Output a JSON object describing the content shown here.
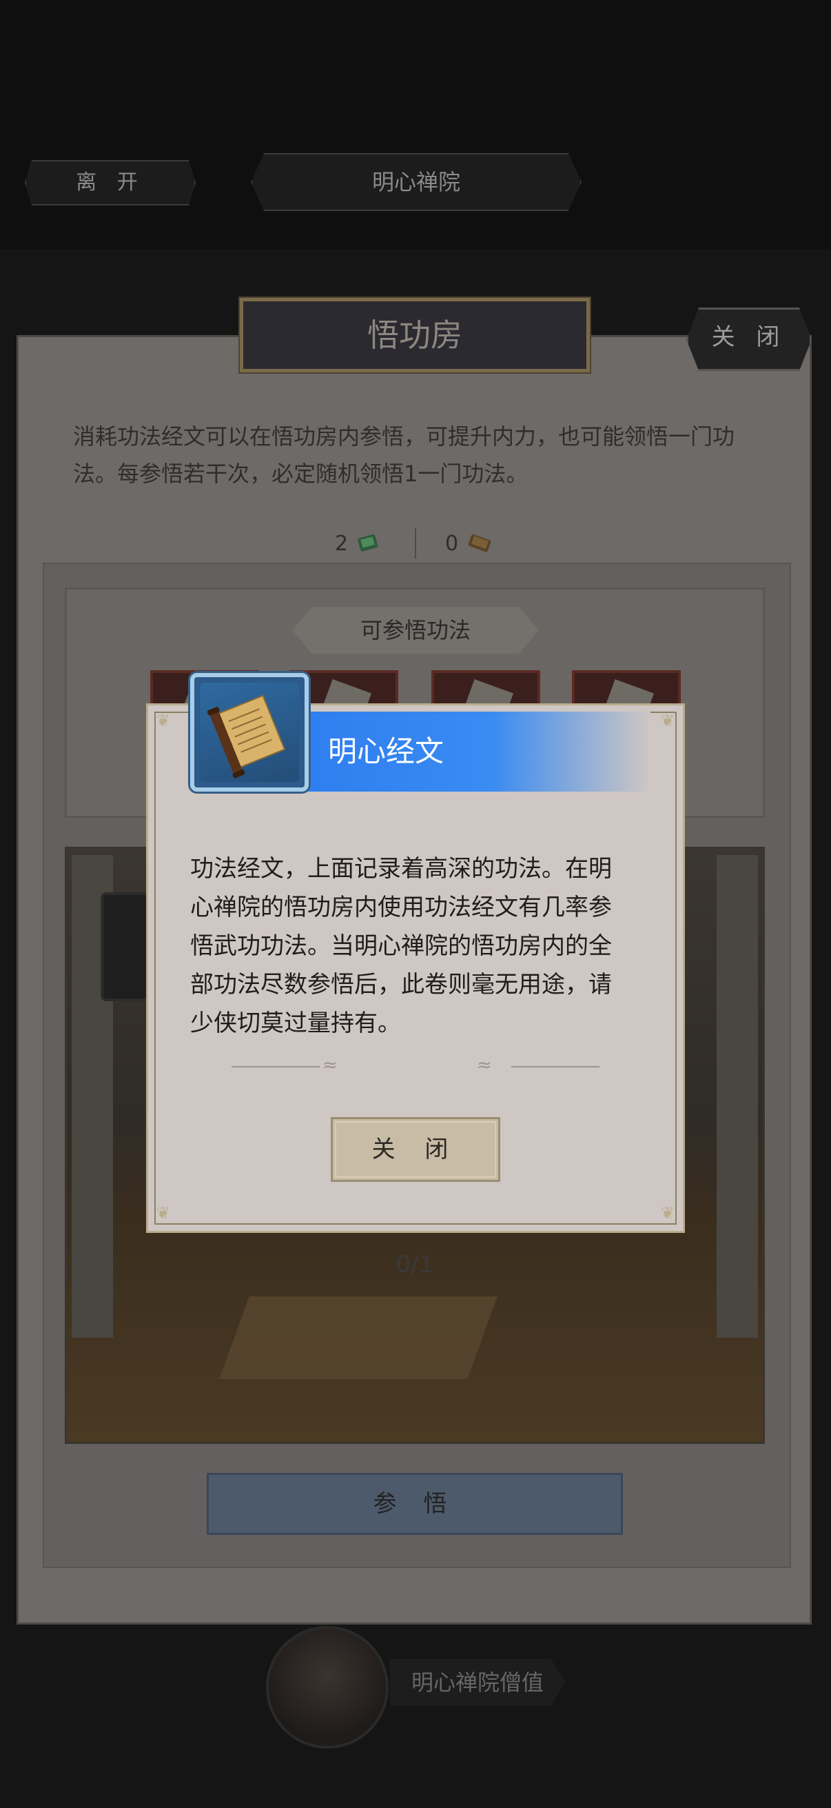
{
  "top_bar": {
    "leave_label": "离 开",
    "location_title": "明心禅院"
  },
  "room": {
    "title": "悟功房",
    "close_label": "关 闭",
    "description": "消耗功法经文可以在悟功房内参悟，可提升内力，也可能领悟一门功法。每参悟若干次，必定随机领悟1一门功法。",
    "resources": [
      {
        "count": "2",
        "icon": "green-scroll-icon"
      },
      {
        "count": "0",
        "icon": "brown-scroll-icon"
      }
    ],
    "learnable_label": "可参悟功法",
    "progress": "0/1",
    "enlighten_label": "参 悟"
  },
  "npc": {
    "name": "明心禅院僧值"
  },
  "dialog": {
    "title": "明心经文",
    "icon": "scroll-icon",
    "description": "功法经文，上面记录着高深的功法。在明心禅院的悟功房内使用功法经文有几率参悟武功功法。当明心禅院的悟功房内的全部功法尽数参悟后，此卷则毫无用途，请少侠切莫过量持有。",
    "close_label": "关 闭"
  },
  "colors": {
    "title_bar_blue": "#2e7ef0",
    "dialog_bg": "#cfc7c3",
    "gold_border": "#b9ad8d"
  }
}
